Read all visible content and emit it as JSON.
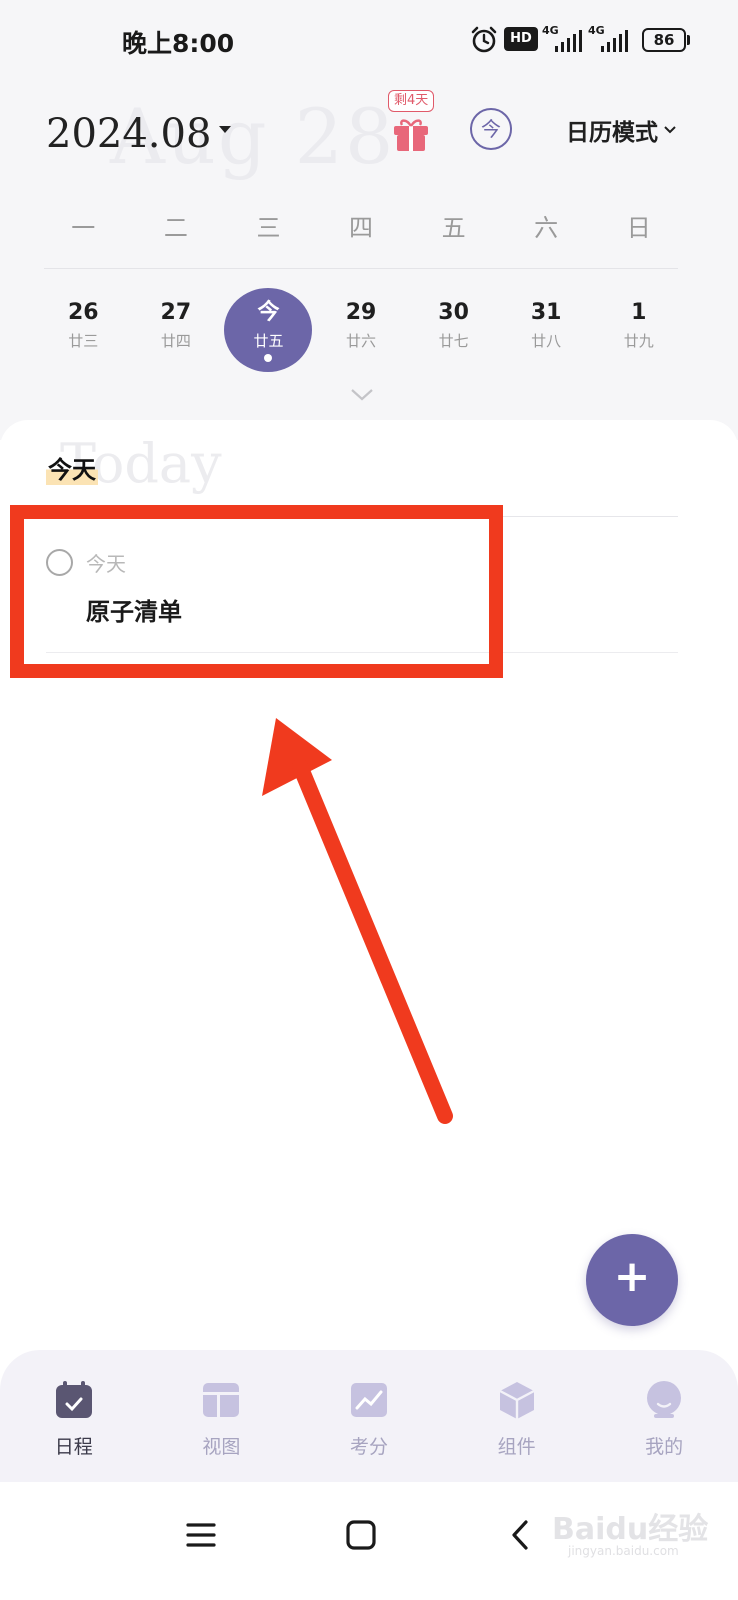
{
  "status_bar": {
    "time": "晚上8:00",
    "hd": "HD",
    "network_1": "4G",
    "network_2": "4G",
    "battery": "86",
    "icons": [
      "alarm-icon",
      "signal-icon",
      "signal-icon",
      "battery-icon"
    ]
  },
  "header": {
    "month": "2024.08",
    "date_watermark": "Aug 28",
    "gift_badge": "剩4天",
    "today_button": "今",
    "mode_label": "日历模式"
  },
  "calendar": {
    "weekdays": [
      "一",
      "二",
      "三",
      "四",
      "五",
      "六",
      "日"
    ],
    "days": [
      {
        "num": "26",
        "lunar": "廿三"
      },
      {
        "num": "27",
        "lunar": "廿四"
      },
      {
        "num": "今",
        "lunar": "廿五",
        "selected": true
      },
      {
        "num": "29",
        "lunar": "廿六"
      },
      {
        "num": "30",
        "lunar": "廿七"
      },
      {
        "num": "31",
        "lunar": "廿八"
      },
      {
        "num": "1",
        "lunar": "廿九"
      }
    ]
  },
  "today_section": {
    "watermark": "Today",
    "title": "今天",
    "tasks": [
      {
        "date": "今天",
        "title": "原子清单",
        "done": false
      }
    ]
  },
  "fab": {
    "label": "+"
  },
  "tabs": [
    {
      "label": "日程",
      "icon": "calendar-icon",
      "active": true
    },
    {
      "label": "视图",
      "icon": "layout-icon",
      "active": false
    },
    {
      "label": "考分",
      "icon": "chart-icon",
      "active": false
    },
    {
      "label": "组件",
      "icon": "cube-icon",
      "active": false
    },
    {
      "label": "我的",
      "icon": "avatar-icon",
      "active": false
    }
  ],
  "watermark": {
    "brand": "Baidu经验",
    "url": "jingyan.baidu.com"
  },
  "colors": {
    "accent": "#6c66a8",
    "annotation": "#f03a1e",
    "gift": "#e05a6a",
    "highlight": "#fbe3b4"
  }
}
